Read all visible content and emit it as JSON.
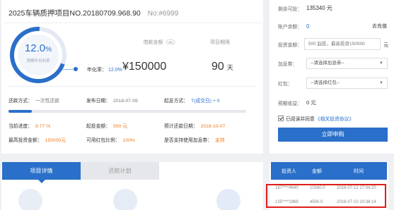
{
  "project": {
    "title": "2025车辆质押项目NO.20180709.968.90",
    "number": "No:#6999",
    "rate_value": "12.0",
    "rate_unit": "%",
    "rate_sub": "预期年化利率",
    "rate_inline_label": "年化率：",
    "rate_inline_value": "12.0%",
    "amount_label": "借款金额（元）",
    "amount_value": "¥150000",
    "period_label": "项目期限",
    "period_value": "90",
    "period_unit": "天",
    "progress_fraction": 0.0977
  },
  "info": {
    "repay_method_label": "还款方式：",
    "repay_method_value": "一次性还款",
    "publish_date_label": "发布日期：",
    "publish_date_value": "2018-07-09",
    "interest_start_label": "起息方式：",
    "interest_start_value": "T(成交日) + 0",
    "progress_label": "当前进度：",
    "progress_value": "9.77 %",
    "min_invest_label": "起投金额：",
    "min_invest_value": "500 元",
    "expected_repay_label": "预计还款日期：",
    "expected_repay_value": "2018-10-07",
    "max_invest_label": "最高投资金额：",
    "max_invest_value": "150000元",
    "redpacket_ratio_label": "可用红包比例：",
    "redpacket_ratio_value": "100%",
    "coupon_label": "是否支持使用加息券：",
    "coupon_value": "支持"
  },
  "invest": {
    "remaining_label": "剩余可投：",
    "remaining_value": "135340 元",
    "balance_label": "账户余额：",
    "balance_value": "0",
    "recharge_label": "去充值",
    "amount_label": "投资金额：",
    "amount_placeholder": "500 起投，最高投资150000",
    "amount_unit": "元",
    "coupon_label": "加息券：",
    "coupon_select": "--请选择加息券--",
    "redpacket_label": "红包：",
    "redpacket_select": "--请选择红包--",
    "earnings_label": "预期收益：",
    "earnings_value": "0 元",
    "agree_text": "已阅读并同意",
    "agree_link": "《相关投资协议》",
    "apply_button": "立即申购"
  },
  "tabs": {
    "details": "项目详情",
    "repay_plan": "还款计划"
  },
  "records": {
    "headers": [
      "投资人",
      "金额",
      "时间"
    ],
    "rows": [
      {
        "investor": "187****4640",
        "amount": "10160.0",
        "time": "2018-07-12 17:04:20"
      },
      {
        "investor": "135****1968",
        "amount": "4500.0",
        "time": "2018-07-10 10:38:14"
      }
    ]
  },
  "colors": {
    "primary": "#2a6fc9",
    "accent": "#f07a1a",
    "highlight": "#e01b1b"
  }
}
